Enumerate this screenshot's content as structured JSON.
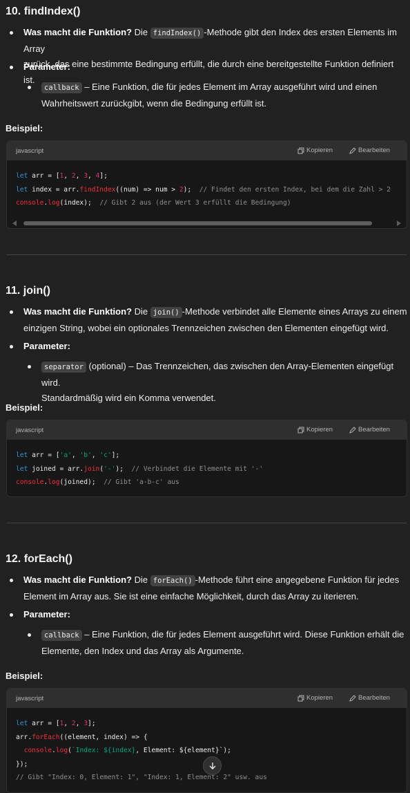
{
  "sections": [
    {
      "title": "10. findIndex()",
      "what_label": "Was macht die Funktion?",
      "what_pre": "Die",
      "what_code": "findIndex()",
      "what_line1": "-Methode gibt den Index des ersten Elements im Array",
      "what_line2": "zurück, das eine bestimmte Bedingung erfüllt, die durch eine bereitgestellte Funktion definiert ist.",
      "param_label": "Parameter:",
      "param_code": "callback",
      "param_line1": "– Eine Funktion, die für jedes Element im Array ausgeführt wird und einen",
      "param_line2": "Wahrheitswert zurückgibt, wenn die Bedingung erfüllt ist.",
      "example_label": "Beispiel:",
      "lang": "javascript",
      "copy_label": "Kopieren",
      "edit_label": "Bearbeiten"
    },
    {
      "title": "11. join()",
      "what_label": "Was macht die Funktion?",
      "what_pre": "Die",
      "what_code": "join()",
      "what_line1": "-Methode verbindet alle Elemente eines Arrays zu einem",
      "what_line2": "einzigen String, wobei ein optionales Trennzeichen zwischen den Elementen eingefügt wird.",
      "param_label": "Parameter:",
      "param_code": "separator",
      "param_line1": "(optional) – Das Trennzeichen, das zwischen den Array-Elementen eingefügt wird.",
      "param_line2": "Standardmäßig wird ein Komma verwendet.",
      "example_label": "Beispiel:",
      "lang": "javascript",
      "copy_label": "Kopieren",
      "edit_label": "Bearbeiten"
    },
    {
      "title": "12. forEach()",
      "what_label": "Was macht die Funktion?",
      "what_pre": "Die",
      "what_code": "forEach()",
      "what_line1": "-Methode führt eine angegebene Funktion für jedes",
      "what_line2": "Element im Array aus. Sie ist eine einfache Möglichkeit, durch das Array zu iterieren.",
      "param_label": "Parameter:",
      "param_code": "callback",
      "param_line1": "– Eine Funktion, die für jedes Element ausgeführt wird. Diese Funktion erhält die",
      "param_line2": "Elemente, den Index und das Array als Argumente.",
      "example_label": "Beispiel:",
      "lang": "javascript",
      "copy_label": "Kopieren",
      "edit_label": "Bearbeiten"
    }
  ],
  "code": {
    "s0": [
      [
        [
          "kw",
          "let"
        ],
        [
          "op",
          " arr = ["
        ],
        [
          "num",
          "1"
        ],
        [
          "op",
          ", "
        ],
        [
          "num",
          "2"
        ],
        [
          "op",
          ", "
        ],
        [
          "num",
          "3"
        ],
        [
          "op",
          ", "
        ],
        [
          "num",
          "4"
        ],
        [
          "op",
          "];"
        ]
      ],
      [
        [
          "kw",
          "let"
        ],
        [
          "op",
          " index = arr."
        ],
        [
          "fn",
          "findIndex"
        ],
        [
          "op",
          "((num) => num > "
        ],
        [
          "num",
          "2"
        ],
        [
          "op",
          ");  "
        ],
        [
          "cm",
          "// Findet den ersten Index, bei dem die Zahl > 2"
        ]
      ],
      [
        [
          "fn",
          "console"
        ],
        [
          "op",
          "."
        ],
        [
          "fn",
          "log"
        ],
        [
          "op",
          "(index);  "
        ],
        [
          "cm",
          "// Gibt 2 aus (der Wert 3 erfüllt die Bedingung)"
        ]
      ]
    ],
    "s1": [
      [
        [
          "kw",
          "let"
        ],
        [
          "op",
          " arr = ["
        ],
        [
          "str",
          "'a'"
        ],
        [
          "op",
          ", "
        ],
        [
          "str",
          "'b'"
        ],
        [
          "op",
          ", "
        ],
        [
          "str",
          "'c'"
        ],
        [
          "op",
          "];"
        ]
      ],
      [
        [
          "kw",
          "let"
        ],
        [
          "op",
          " joined = arr."
        ],
        [
          "fn",
          "join"
        ],
        [
          "op",
          "("
        ],
        [
          "str",
          "'-'"
        ],
        [
          "op",
          ");  "
        ],
        [
          "cm",
          "// Verbindet die Elemente mit '-'"
        ]
      ],
      [
        [
          "fn",
          "console"
        ],
        [
          "op",
          "."
        ],
        [
          "fn",
          "log"
        ],
        [
          "op",
          "(joined);  "
        ],
        [
          "cm",
          "// Gibt 'a-b-c' aus"
        ]
      ]
    ],
    "s2": [
      [
        [
          "kw",
          "let"
        ],
        [
          "op",
          " arr = ["
        ],
        [
          "num",
          "1"
        ],
        [
          "op",
          ", "
        ],
        [
          "num",
          "2"
        ],
        [
          "op",
          ", "
        ],
        [
          "num",
          "3"
        ],
        [
          "op",
          "];"
        ]
      ],
      [
        [
          "op",
          "arr."
        ],
        [
          "fn",
          "forEach"
        ],
        [
          "op",
          "((element, index) => {"
        ]
      ],
      [
        [
          "op",
          "  "
        ],
        [
          "fn",
          "console"
        ],
        [
          "op",
          "."
        ],
        [
          "fn",
          "log"
        ],
        [
          "op",
          "("
        ],
        [
          "str",
          "`Index: ${index}"
        ],
        [
          "op",
          ", Element: ${element}`);"
        ]
      ],
      [
        [
          "op",
          "});"
        ]
      ],
      [
        [
          "cm",
          "// Gibt \"Index: 0, Element: 1\", \"Index: 1, Element: 2\" usw. aus"
        ]
      ]
    ]
  },
  "colors": {
    "background": "#212121",
    "code_bg": "#171717",
    "keyword": "#2e95d3",
    "number": "#df3079",
    "function": "#f22c3d",
    "string": "#00a67d",
    "comment": "#8f8f8f"
  },
  "icons": {
    "copy": "copy-icon",
    "edit": "pencil-icon",
    "scroll_down": "arrow-down-icon"
  }
}
